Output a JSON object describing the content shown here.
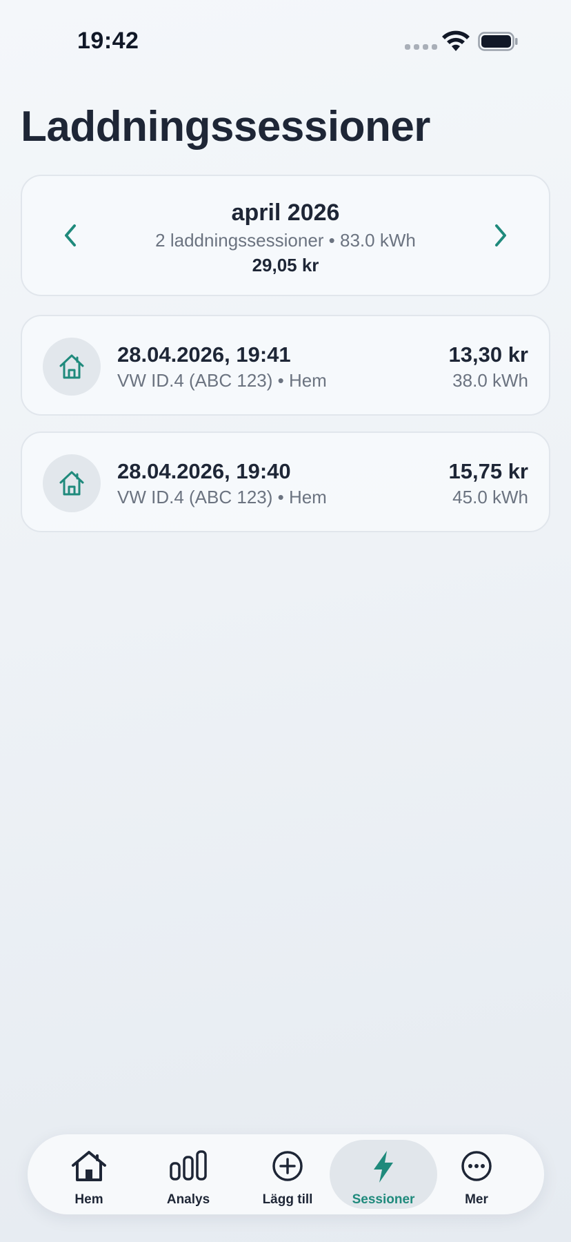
{
  "status_bar": {
    "time": "19:42"
  },
  "page": {
    "title": "Laddningssessioner"
  },
  "month_card": {
    "title": "april 2026",
    "summary": "2 laddningssessioner • 83.0 kWh",
    "total": "29,05 kr",
    "prev_icon": "chevron-left-icon",
    "next_icon": "chevron-right-icon"
  },
  "sessions": [
    {
      "icon": "home-icon",
      "date": "28.04.2026, 19:41",
      "subtitle": "VW ID.4 (ABC 123) • Hem",
      "cost": "13,30 kr",
      "energy": "38.0 kWh"
    },
    {
      "icon": "home-icon",
      "date": "28.04.2026, 19:40",
      "subtitle": "VW ID.4 (ABC 123) • Hem",
      "cost": "15,75 kr",
      "energy": "45.0 kWh"
    }
  ],
  "tab_bar": {
    "tabs": [
      {
        "label": "Hem",
        "icon": "home-icon",
        "active": false
      },
      {
        "label": "Analys",
        "icon": "bar-chart-icon",
        "active": false
      },
      {
        "label": "Lägg till",
        "icon": "plus-circle-icon",
        "active": false
      },
      {
        "label": "Sessioner",
        "icon": "bolt-icon",
        "active": true
      },
      {
        "label": "Mer",
        "icon": "more-icon",
        "active": false
      }
    ]
  },
  "colors": {
    "accent": "#1f8a7c",
    "text": "#1e2636",
    "muted": "#6b7380"
  }
}
